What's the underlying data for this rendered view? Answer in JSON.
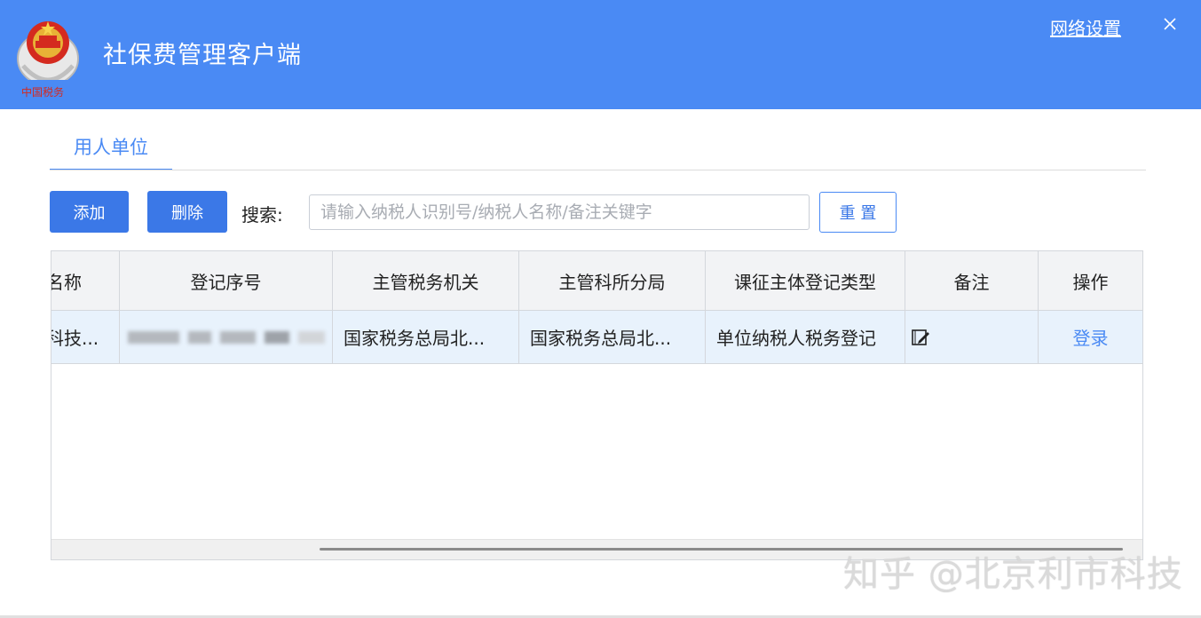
{
  "header": {
    "title": "社保费管理客户端",
    "network_settings": "网络设置",
    "logo_icon": "national-emblem-icon",
    "logo_text": "中国税务",
    "close_icon": "close-icon",
    "bg_color": "#4a8af4"
  },
  "tabs": [
    {
      "label": "用人单位",
      "active": true
    }
  ],
  "toolbar": {
    "add_label": "添加",
    "delete_label": "删除",
    "search_label": "搜索:",
    "search_placeholder": "请输入纳税人识别号/纳税人名称/备注关键字",
    "search_value": "",
    "reset_label": "重 置"
  },
  "table": {
    "columns": [
      "名称",
      "登记序号",
      "主管税务机关",
      "主管科所分局",
      "课征主体登记类型",
      "备注",
      "操作"
    ],
    "rows": [
      {
        "name": "科技...",
        "reg_no": "",
        "tax_authority": "国家税务总局北...",
        "branch": "国家税务总局北...",
        "reg_type": "单位纳税人税务登记",
        "note_icon": "edit-note-icon",
        "action": "登录"
      }
    ]
  },
  "watermark": "知乎 @北京利市科技"
}
